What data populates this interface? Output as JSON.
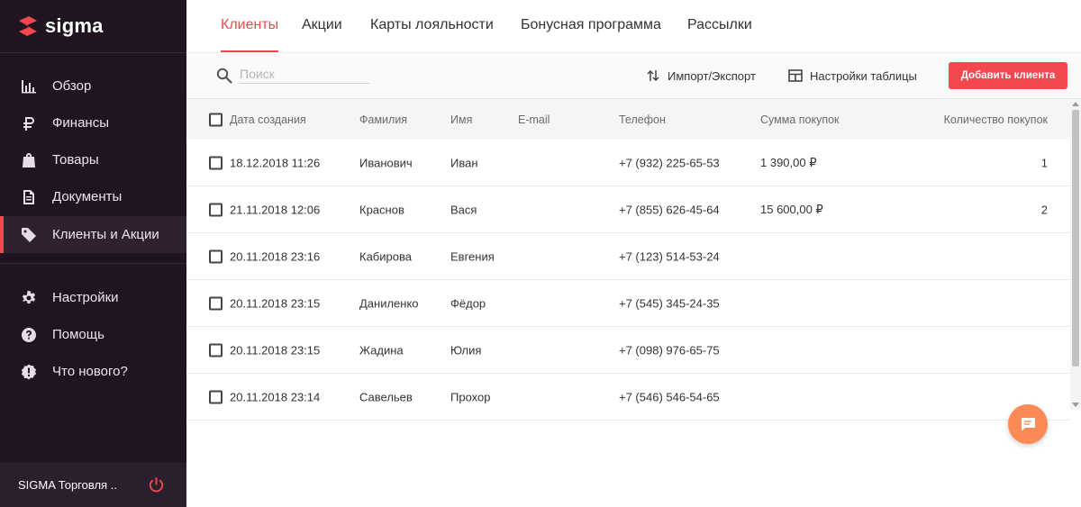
{
  "app": {
    "logo_text": "sigma"
  },
  "sidebar": {
    "items": [
      {
        "label": "Обзор",
        "icon": "chart-bars-icon"
      },
      {
        "label": "Финансы",
        "icon": "ruble-icon"
      },
      {
        "label": "Товары",
        "icon": "shopping-bag-icon"
      },
      {
        "label": "Документы",
        "icon": "document-icon"
      },
      {
        "label": "Клиенты и Акции",
        "icon": "tag-icon",
        "active": true
      },
      {
        "label": "Настройки",
        "icon": "gear-icon"
      },
      {
        "label": "Помощь",
        "icon": "help-icon"
      },
      {
        "label": "Что нового?",
        "icon": "alert-badge-icon"
      }
    ],
    "footer": {
      "company": "SIGMA Торговля ..",
      "icon": "power-icon"
    }
  },
  "tabs": [
    {
      "label": "Клиенты",
      "active": true
    },
    {
      "label": "Акции"
    },
    {
      "label": "Карты лояльности"
    },
    {
      "label": "Бонусная программа"
    },
    {
      "label": "Рассылки"
    }
  ],
  "toolbar": {
    "search_placeholder": "Поиск",
    "search_value": "",
    "import_export_label": "Импорт/Экспорт",
    "table_settings_label": "Настройки таблицы",
    "add_client_label": "Добавить клиента"
  },
  "table": {
    "headers": {
      "date": "Дата создания",
      "last_name": "Фамилия",
      "first_name": "Имя",
      "email": "E-mail",
      "phone": "Телефон",
      "sum": "Сумма покупок",
      "count": "Количество покупок"
    },
    "rows": [
      {
        "date": "18.12.2018 11:26",
        "last_name": "Иванович",
        "first_name": "Иван",
        "email": "",
        "phone": "+7 (932) 225-65-53",
        "sum": "1 390,00 ₽",
        "count": "1"
      },
      {
        "date": "21.11.2018 12:06",
        "last_name": "Краснов",
        "first_name": "Вася",
        "email": "",
        "phone": "+7 (855) 626-45-64",
        "sum": "15 600,00 ₽",
        "count": "2"
      },
      {
        "date": "20.11.2018 23:16",
        "last_name": "Кабирова",
        "first_name": "Евгения",
        "email": "",
        "phone": "+7 (123) 514-53-24",
        "sum": "",
        "count": ""
      },
      {
        "date": "20.11.2018 23:15",
        "last_name": "Даниленко",
        "first_name": "Фёдор",
        "email": "",
        "phone": "+7 (545) 345-24-35",
        "sum": "",
        "count": ""
      },
      {
        "date": "20.11.2018 23:15",
        "last_name": "Жадина",
        "first_name": "Юлия",
        "email": "",
        "phone": "+7 (098) 976-65-75",
        "sum": "",
        "count": ""
      },
      {
        "date": "20.11.2018 23:14",
        "last_name": "Савельев",
        "first_name": "Прохор",
        "email": "",
        "phone": "+7 (546) 546-54-65",
        "sum": "",
        "count": ""
      }
    ]
  },
  "colors": {
    "accent": "#f5474e",
    "sidebar_bg": "#1f1420",
    "chat_button": "#fb8a57"
  },
  "chat": {
    "icon": "chat-icon"
  }
}
